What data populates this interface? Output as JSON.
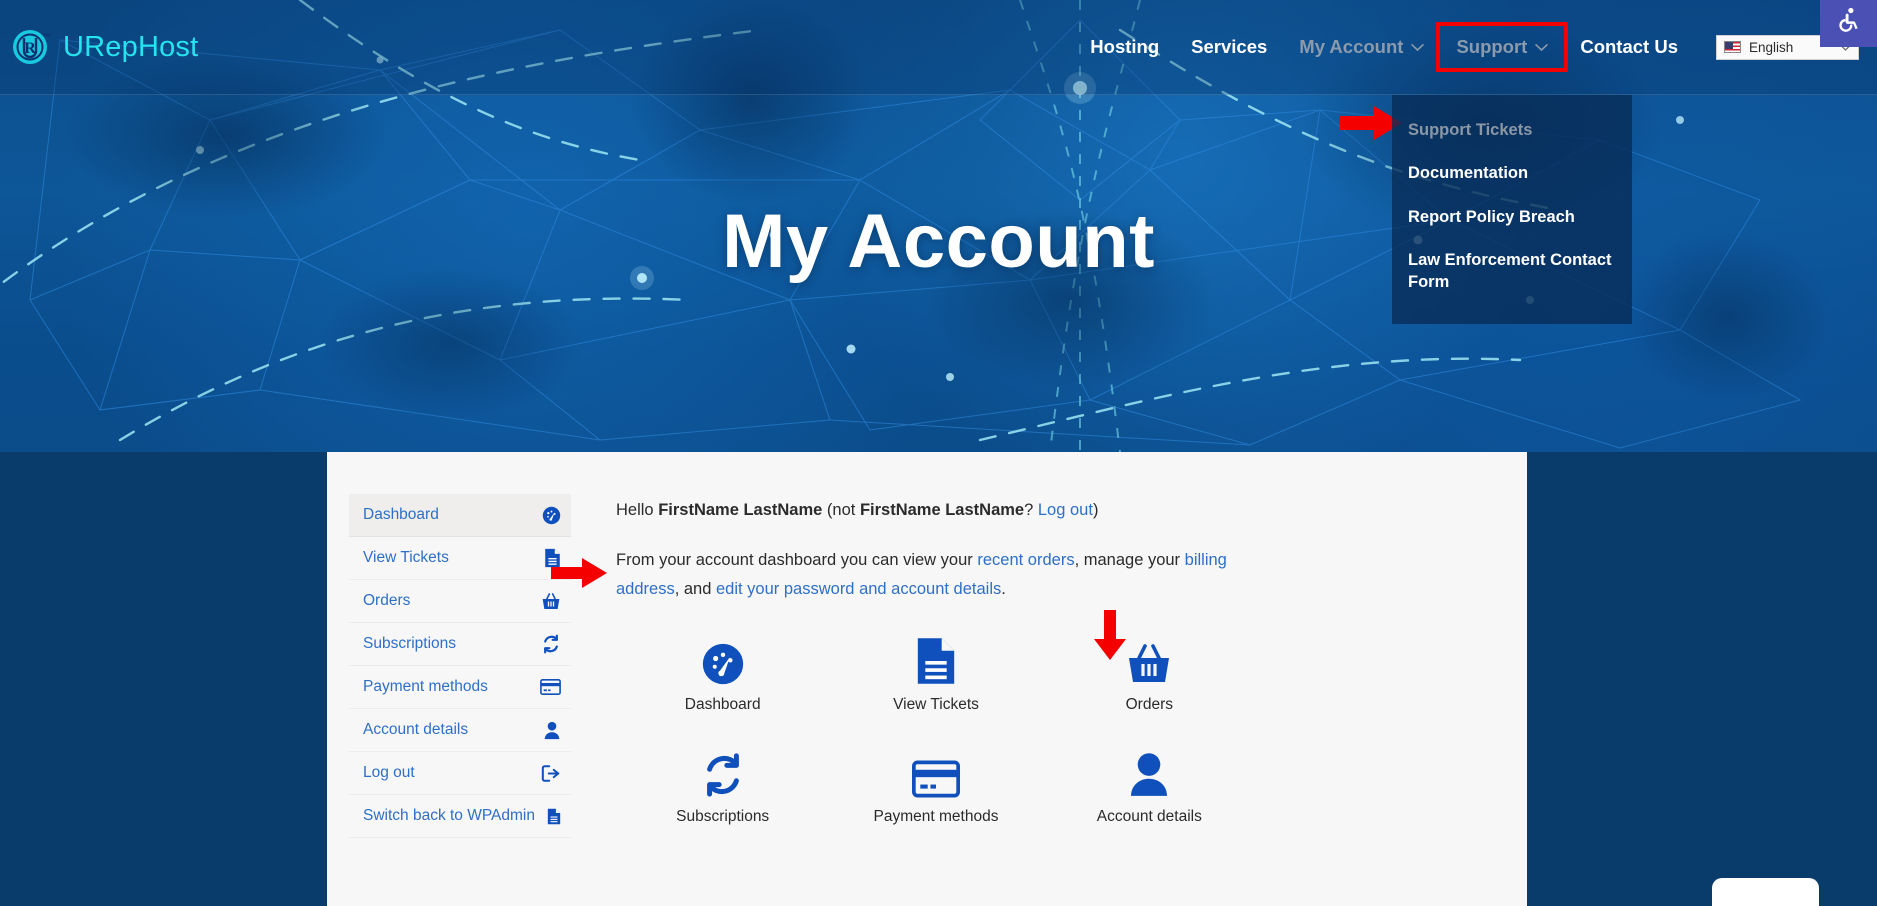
{
  "brand": {
    "name": "URepHost",
    "logo_icon": "urephost-circle-r-logo",
    "accent": "#26e3f0"
  },
  "header": {
    "nav": [
      {
        "label": "Hosting",
        "muted": false,
        "caret": false,
        "highlighted": false
      },
      {
        "label": "Services",
        "muted": false,
        "caret": false,
        "highlighted": false
      },
      {
        "label": "My Account",
        "muted": true,
        "caret": true,
        "highlighted": false
      },
      {
        "label": "Support",
        "muted": true,
        "caret": true,
        "highlighted": true
      },
      {
        "label": "Contact Us",
        "muted": false,
        "caret": false,
        "highlighted": false
      }
    ],
    "language": {
      "value": "English",
      "icon": "us-flag-icon",
      "caret": "chevron-down-icon"
    },
    "accessibility": {
      "icon": "wheelchair-accessibility-icon",
      "color": "#4b50b4"
    },
    "highlight_color": "#f40000"
  },
  "dropdown": {
    "owner": "Support",
    "items": [
      {
        "label": "Support Tickets",
        "muted": true
      },
      {
        "label": "Documentation",
        "muted": false
      },
      {
        "label": "Report Policy Breach",
        "muted": false
      },
      {
        "label": "Law Enforcement Contact Form",
        "muted": false
      }
    ]
  },
  "hero": {
    "title": "My Account"
  },
  "account": {
    "sidebar": [
      {
        "label": "Dashboard",
        "icon": "dashboard-gauge-icon",
        "active": true
      },
      {
        "label": "View Tickets",
        "icon": "document-icon",
        "active": false
      },
      {
        "label": "Orders",
        "icon": "basket-icon",
        "active": false
      },
      {
        "label": "Subscriptions",
        "icon": "refresh-cycle-icon",
        "active": false
      },
      {
        "label": "Payment methods",
        "icon": "credit-card-icon",
        "active": false
      },
      {
        "label": "Account details",
        "icon": "person-icon",
        "active": false
      },
      {
        "label": "Log out",
        "icon": "logout-icon",
        "active": false
      },
      {
        "label": "Switch back to WPAdmin",
        "icon": "document-icon",
        "active": false
      }
    ],
    "greeting": {
      "hello": "Hello ",
      "name": "FirstName LastName",
      "not_open": " (not ",
      "not_name": "FirstName LastName",
      "question": "? ",
      "logout_link": "Log out",
      "close": ")"
    },
    "intro": {
      "part1": "From your account dashboard you can view your ",
      "link1": "recent orders",
      "part2": ", manage your ",
      "link2": "billing address",
      "part3": ", and ",
      "link3": "edit your password and account details",
      "part4": "."
    },
    "tiles": [
      {
        "label": "Dashboard",
        "icon": "dashboard-gauge-icon"
      },
      {
        "label": "View Tickets",
        "icon": "document-icon"
      },
      {
        "label": "Orders",
        "icon": "basket-icon"
      },
      {
        "label": "Subscriptions",
        "icon": "refresh-cycle-icon"
      },
      {
        "label": "Payment methods",
        "icon": "credit-card-icon"
      },
      {
        "label": "Account details",
        "icon": "person-icon"
      }
    ],
    "icon_color": "#1050bc",
    "link_color": "#2e6fc7"
  },
  "annotations": [
    {
      "name": "arrow-to-support-tickets",
      "direction": "right"
    },
    {
      "name": "arrow-to-view-tickets-sidebar",
      "direction": "right"
    },
    {
      "name": "arrow-to-view-tickets-tile",
      "direction": "down"
    }
  ]
}
